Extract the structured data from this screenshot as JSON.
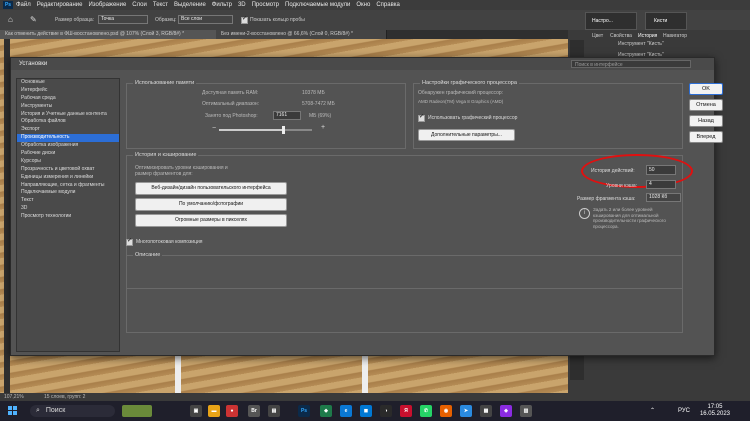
{
  "menubar": {
    "items": [
      "Файл",
      "Редактирование",
      "Изображение",
      "Слои",
      "Текст",
      "Выделение",
      "Фильтр",
      "3D",
      "Просмотр",
      "Подключаемые модули",
      "Окно",
      "Справка"
    ]
  },
  "optbar": {
    "sample_size_label": "Размер образца:",
    "sample_size_value": "Точка",
    "sample_label": "Образец:",
    "sample_value": "Все слои",
    "show_ring": "Показать кольцо пробы",
    "panel_settings": "Настро...",
    "panel_brushes": "Кисти"
  },
  "doc_tabs": [
    "Как отменить действие в ФШ-восстановлено.psd @ 107% (Слой 3, RGB/8#) *",
    "Без имени-2-восстановлено @ 66,6% (Слой 0, RGB/8#) *"
  ],
  "right_panel": {
    "tabs": [
      "Цвет",
      "Свойства",
      "История",
      "Навигатор"
    ],
    "items": [
      "Инструмент \"Кисть\"",
      "Инструмент \"Кисть\""
    ]
  },
  "dialog": {
    "title": "Установки",
    "search_placeholder": "Поиск в интерфейсе",
    "sidebar": [
      "Основные",
      "Интерфейс",
      "Рабочая среда",
      "Инструменты",
      "История и Учетные данные контента",
      "Обработка файлов",
      "Экспорт",
      "Производительность",
      "Обработка изображения",
      "Рабочие диски",
      "Курсоры",
      "Прозрачность и цветовой охват",
      "Единицы измерения и линейки",
      "Направляющие, сетка и фрагменты",
      "Подключаемые модули",
      "Текст",
      "3D",
      "Просмотр технологии"
    ],
    "active_index": 7,
    "memory": {
      "title": "Использование памяти",
      "available_label": "Доступная память RAM:",
      "available_value": "10378 МБ",
      "ideal_label": "Оптимальный диапазон:",
      "ideal_value": "5708-7472 МБ",
      "used_label": "Занято под Photoshop:",
      "used_value": "7161",
      "used_unit": "МБ (69%)",
      "minus": "−",
      "plus": "+",
      "slider_fraction": 0.69
    },
    "gpu": {
      "title": "Настройки графического процессора",
      "detected_label": "Обнаружен графический процессор:",
      "detected_value": "AMD Radeon(TM) Vega 8 Graphics (AMD)",
      "use_gpu": "Использовать графический процессор",
      "advanced": "Дополнительные параметры..."
    },
    "history": {
      "title": "История и кэширование",
      "optimize_text": "Оптимизировать уровни кэширования и размер фрагментов для:",
      "btn_web": "Веб-дизайн/дизайн пользовательского интерфейса",
      "btn_default": "По умолчанию/фотографии",
      "btn_large": "Огромные размеры в пикселях",
      "states_label": "История действий:",
      "states_value": "50",
      "cache_levels_label": "Уровни кэша:",
      "cache_levels_value": "4",
      "tile_label": "Размер фрагмента кэша:",
      "tile_value": "1028 Кб",
      "info": "Задать 2 или более уровней кэширования для оптимальной производительности графического процессора."
    },
    "multithread": "Многопотоковая композиция",
    "description_title": "Описание",
    "buttons": {
      "ok": "OK",
      "cancel": "Отмена",
      "back": "Назад",
      "forward": "Вперед"
    }
  },
  "statusbar": {
    "zoom": "107,21%",
    "info": "15 слоев, групп: 2"
  },
  "taskbar": {
    "search": "Поиск",
    "lang": "РУС",
    "time": "17:05",
    "date": "16.05.2023"
  },
  "colors": {
    "accent": "#2c6ed6",
    "highlight_circle": "#e01010"
  }
}
